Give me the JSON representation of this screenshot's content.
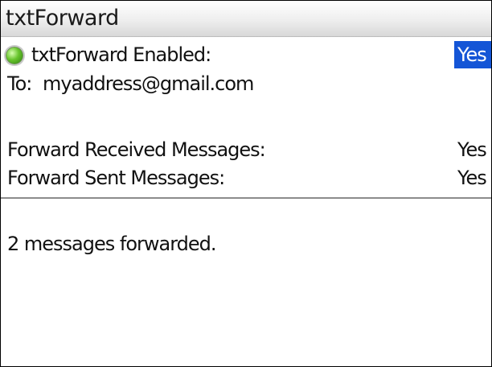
{
  "window": {
    "title": "txtForward"
  },
  "settings": {
    "enabled": {
      "icon": "green-status-led-icon",
      "label": "txtForward Enabled:",
      "value": "Yes"
    },
    "to": {
      "label": "To:",
      "value": "myaddress@gmail.com"
    },
    "forward_received": {
      "label": "Forward Received Messages:",
      "value": "Yes"
    },
    "forward_sent": {
      "label": "Forward Sent Messages:",
      "value": "Yes"
    }
  },
  "status": {
    "text": "2 messages forwarded."
  },
  "colors": {
    "selection": "#1455d6",
    "status_led": "#68c52d",
    "divider": "#8c8c8c"
  }
}
